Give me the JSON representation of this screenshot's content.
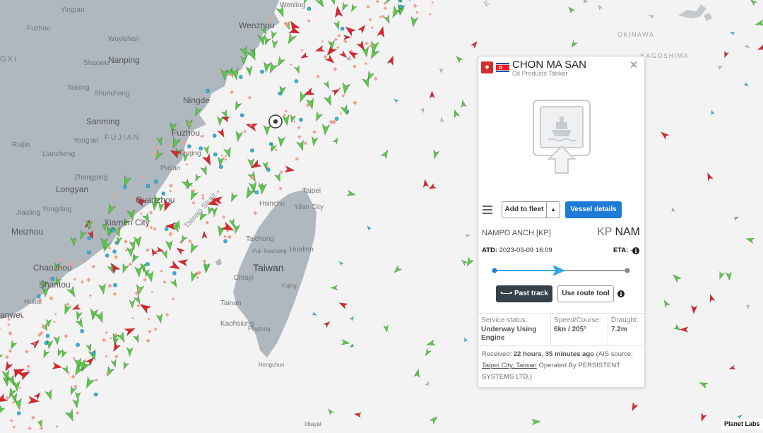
{
  "map": {
    "labels": {
      "yingtan": "Yingtan",
      "wenling": "Wenling",
      "wenzhou": "Wenzhou",
      "fuzhou_jx": "Fuzhou",
      "wuyishan": "Wuyishan",
      "nanping": "Nanping",
      "shaowu": "Shaowu",
      "gxi": "GXI",
      "taining": "Taining",
      "shunchang": "Shunchang",
      "ningde": "Ningde",
      "sanming": "Sanming",
      "fujian": "FUJIAN",
      "fuzhou": "Fuzhou",
      "fuqing": "Fuqing",
      "yongan": "Yong'an",
      "ruijin": "Ruijin",
      "liancheng": "Liancheng",
      "putian": "Putian",
      "zhangping": "Zhangping",
      "longyan": "Longyan",
      "quanzhou": "Quanzhou",
      "jiaoling": "Jiaoling",
      "yongding": "Yongding",
      "xiamen": "Xiamen City",
      "meizhou": "Meizhou",
      "chaozhou": "Chaozhou",
      "shantou": "Shantou",
      "huilai": "Huilai",
      "anwei": "anwei",
      "taiwan_strait": "Taiwan Strait",
      "taipei": "Taipei",
      "yilan": "Yilan City",
      "hsinchu": "Hsinchu",
      "taichung": "Taichung",
      "puli": "Puli Township",
      "hualien": "Hualien",
      "taiwan": "Taiwan",
      "chiayi": "Chiayi",
      "yujing": "Yujing",
      "tainan": "Tainan",
      "kaohsiung": "Kaohsiung",
      "pingtung": "Pingtung",
      "hengchun": "Hengchun",
      "okinawa": "OKINAWA",
      "kagoshima": "KAGOSHIMA",
      "ibayat": "Itbayat",
      "corner_e": "E"
    }
  },
  "panel": {
    "vessel_name": "CHON MA SAN",
    "vessel_type": "Oil Products Tanker",
    "close_symbol": "×",
    "type_icon": "oil-drop-icon",
    "flag": "north-korea-flag",
    "buttons": {
      "add_to_fleet": "Add to fleet",
      "caret": "▲",
      "vessel_details": "Vessel details",
      "past_track": "Past track",
      "use_route_tool": "Use route tool"
    },
    "departure_port": "NAMPO ANCH [KP]",
    "destination_country": "KP",
    "destination_port": "NAM",
    "atd_label": "ATD:",
    "atd_value": "2023-03-09 16:09",
    "eta_label": "ETA:",
    "eta_value": "-",
    "route_progress": 0.49,
    "stats": {
      "service_status_label": "Service status:",
      "service_status_value": "Underway Using Engine",
      "speed_course_label": "Speed/Course:",
      "speed_course_value": "6kn / 205°",
      "draught_label": "Draught:",
      "draught_value": "7.2m"
    },
    "received": {
      "prefix": "Received:",
      "time_ago": "22 hours, 35 minutes ago",
      "ais_text": "(AIS source:",
      "source_link": "Taipei City, Taiwan",
      "operated_by": "Operated By PERSISTENT SYSTEMS LTD.)"
    }
  },
  "credit": "Planet Labs",
  "colors": {
    "sea": "#f3f3f3",
    "land": "#b0b8bf",
    "cargo_green": "#5cc84a",
    "tanker_red": "#e0232b",
    "fishing_salmon": "#f0a08c",
    "passenger_blue": "#2fb8e6",
    "primary_button": "#1e7bd8"
  }
}
